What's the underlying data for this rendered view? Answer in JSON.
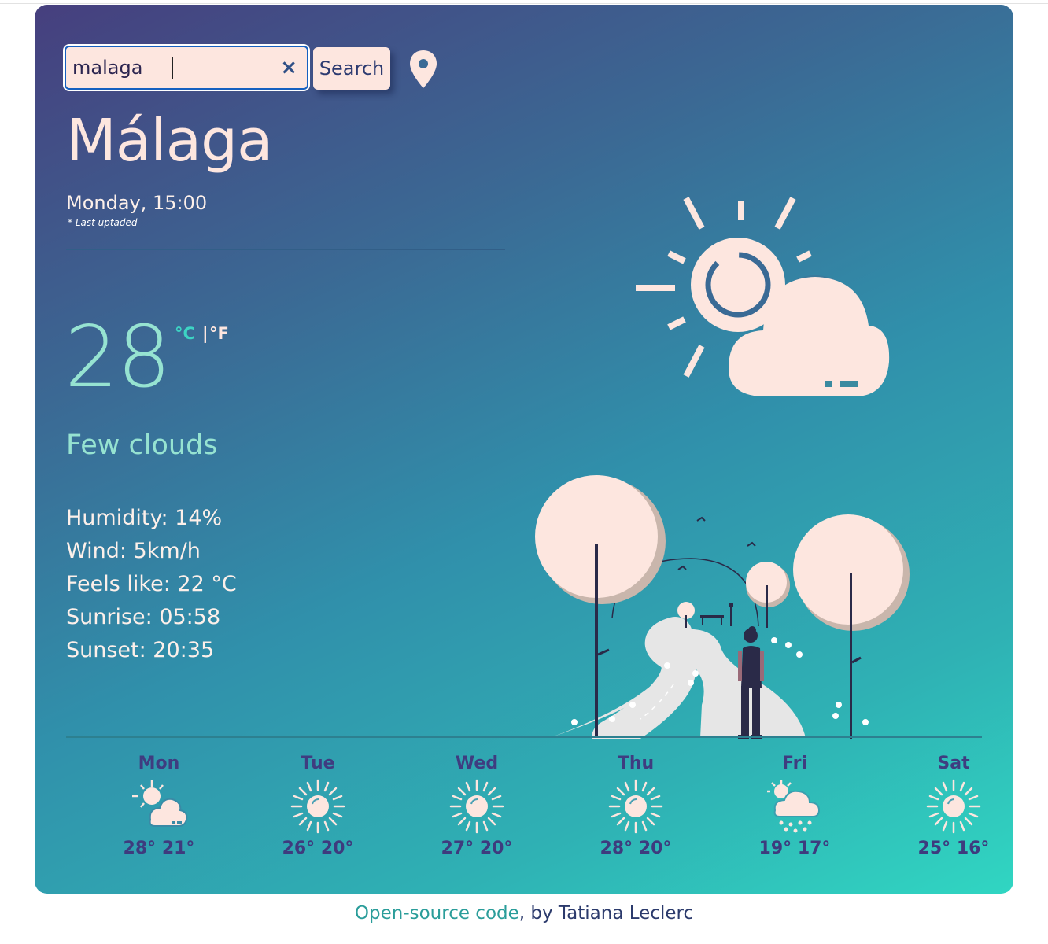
{
  "search": {
    "value": "malaga",
    "clear_symbol": "×",
    "button_label": "Search"
  },
  "current": {
    "city": "Málaga",
    "datetime": "Monday, 15:00",
    "last_updated_note": "* Last uptaded",
    "temperature": "28",
    "unit_c": "°C",
    "unit_separator": "|",
    "unit_f": "°F",
    "condition": "Few clouds",
    "icon": "sun-behind-cloud-icon",
    "details": [
      "Humidity: 14%",
      "Wind: 5km/h",
      "Feels like: 22 °C",
      "Sunrise: 05:58",
      "Sunset: 20:35"
    ]
  },
  "forecast": [
    {
      "day": "Mon",
      "temps": "28° 21°",
      "icon": "sun-cloud-icon"
    },
    {
      "day": "Tue",
      "temps": "26° 20°",
      "icon": "sun-icon"
    },
    {
      "day": "Wed",
      "temps": "27° 20°",
      "icon": "sun-icon"
    },
    {
      "day": "Thu",
      "temps": "28° 20°",
      "icon": "sun-icon"
    },
    {
      "day": "Fri",
      "temps": "19° 17°",
      "icon": "sun-cloud-rain-icon"
    },
    {
      "day": "Sat",
      "temps": "25° 16°",
      "icon": "sun-icon"
    }
  ],
  "footer": {
    "link_text": "Open-source code",
    "suffix": ", by Tatiana Leclerc"
  },
  "colors": {
    "cream": "#fde6df",
    "mint": "#96e3d1",
    "teal_accent": "#3dd4c4",
    "navy_text": "#3f3c80",
    "gradient_start": "#463f7e",
    "gradient_end": "#30d6c2"
  }
}
